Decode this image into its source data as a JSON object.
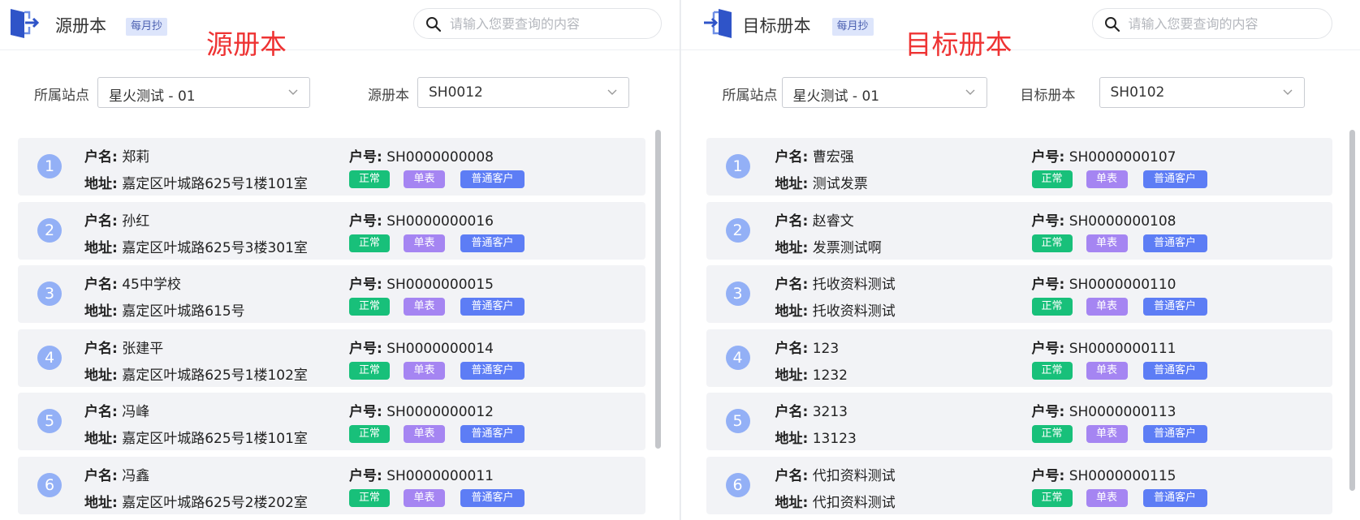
{
  "source": {
    "title": "源册本",
    "badge": "每月抄",
    "red_label": "源册本",
    "search_placeholder": "请输入您要查询的内容",
    "site_label": "所属站点",
    "site_value": "星火测试 - 01",
    "book_label": "源册本",
    "book_value": "SH0012",
    "name_key": "户名:",
    "addr_key": "地址:",
    "acct_key": "户号:",
    "tags": [
      "正常",
      "单表",
      "普通客户"
    ],
    "items": [
      {
        "num": "1",
        "name": "郑莉",
        "addr": "嘉定区叶城路625号1楼101室",
        "acct": "SH0000000008"
      },
      {
        "num": "2",
        "name": "孙红",
        "addr": "嘉定区叶城路625号3楼301室",
        "acct": "SH0000000016"
      },
      {
        "num": "3",
        "name": "45中学校",
        "addr": "嘉定区叶城路615号",
        "acct": "SH0000000015"
      },
      {
        "num": "4",
        "name": "张建平",
        "addr": "嘉定区叶城路625号1楼102室",
        "acct": "SH0000000014"
      },
      {
        "num": "5",
        "name": "冯峰",
        "addr": "嘉定区叶城路625号1楼101室",
        "acct": "SH0000000012"
      },
      {
        "num": "6",
        "name": "冯鑫",
        "addr": "嘉定区叶城路625号2楼202室",
        "acct": "SH0000000011"
      }
    ]
  },
  "target": {
    "title": "目标册本",
    "badge": "每月抄",
    "red_label": "目标册本",
    "search_placeholder": "请输入您要查询的内容",
    "site_label": "所属站点",
    "site_value": "星火测试 - 01",
    "book_label": "目标册本",
    "book_value": "SH0102",
    "name_key": "户名:",
    "addr_key": "地址:",
    "acct_key": "户号:",
    "tags": [
      "正常",
      "单表",
      "普通客户"
    ],
    "items": [
      {
        "num": "1",
        "name": "曹宏强",
        "addr": "测试发票",
        "acct": "SH0000000107"
      },
      {
        "num": "2",
        "name": "赵睿文",
        "addr": "发票测试啊",
        "acct": "SH0000000108"
      },
      {
        "num": "3",
        "name": "托收资料测试",
        "addr": "托收资料测试",
        "acct": "SH0000000110"
      },
      {
        "num": "4",
        "name": "123",
        "addr": "1232",
        "acct": "SH0000000111"
      },
      {
        "num": "5",
        "name": "3213",
        "addr": "13123",
        "acct": "SH0000000113"
      },
      {
        "num": "6",
        "name": "代扣资料测试",
        "addr": "代扣资料测试",
        "acct": "SH0000000115"
      }
    ]
  },
  "colors": {
    "tag_normal": "#18c07a",
    "tag_single": "#a585f2",
    "tag_customer": "#5d7df5",
    "red_label": "#ee3333",
    "number_circle": "#93b0f6"
  },
  "icons": {
    "source_logo": "exit-door-icon",
    "target_logo": "enter-door-icon",
    "search": "search-icon",
    "select_arrow": "chevron-down-icon"
  }
}
